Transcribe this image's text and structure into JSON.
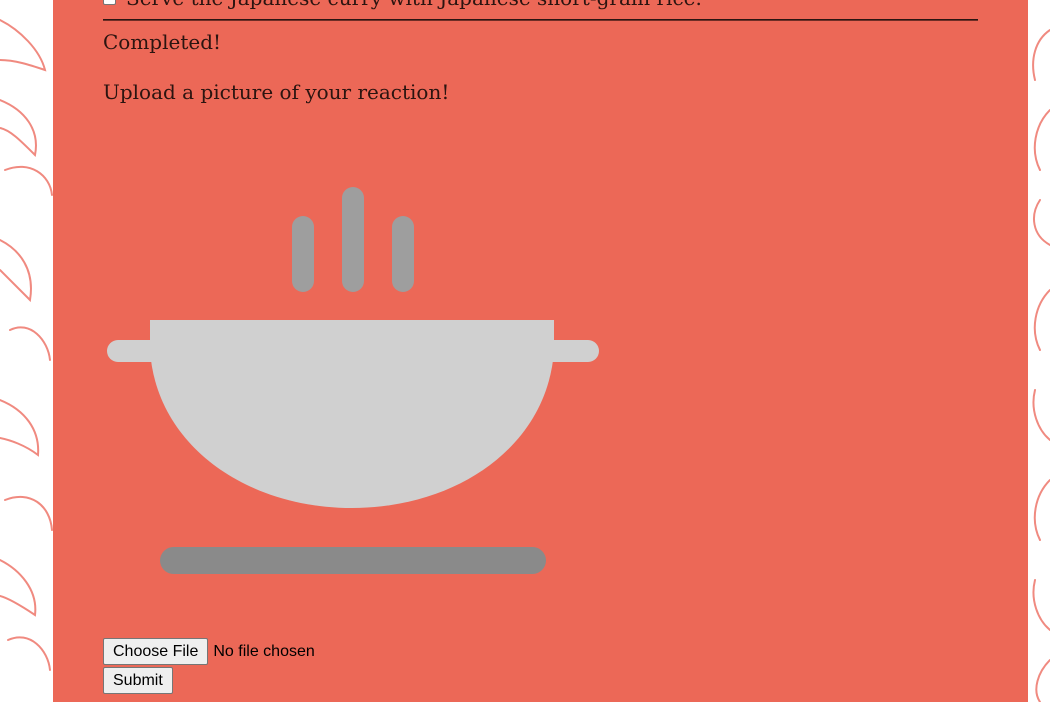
{
  "recipe_step": {
    "text": "Serve the Japanese curry with Japanese short-grain rice.",
    "checked": false
  },
  "status": {
    "completed_text": "Completed!"
  },
  "upload": {
    "prompt": "Upload a picture of your reaction!",
    "choose_file_label": "Choose File",
    "file_status": "No file chosen",
    "submit_label": "Submit"
  },
  "colors": {
    "card_background": "#ec6857",
    "page_pattern": "#f08a80",
    "wok_body": "#d0d0d0",
    "steam": "#9e9e9e",
    "burner": "#8a8a8a"
  },
  "icons": {
    "illustration": "wok-icon"
  }
}
